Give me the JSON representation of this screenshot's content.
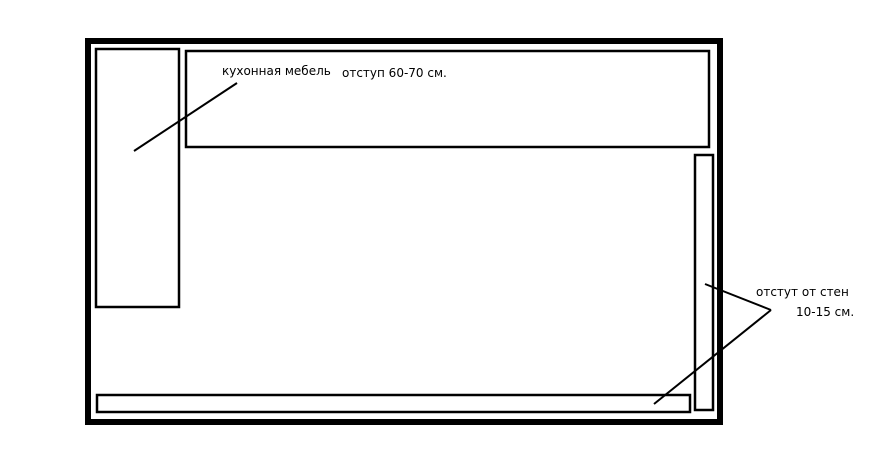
{
  "labels": {
    "kitchen_furniture": "кухонная мебель",
    "offset_furniture": "отступ 60-70 см.",
    "wall_offset_line1": "отстут от стен",
    "wall_offset_line2": "10-15 см."
  },
  "colors": {
    "stroke": "#000000",
    "background": "#ffffff"
  }
}
